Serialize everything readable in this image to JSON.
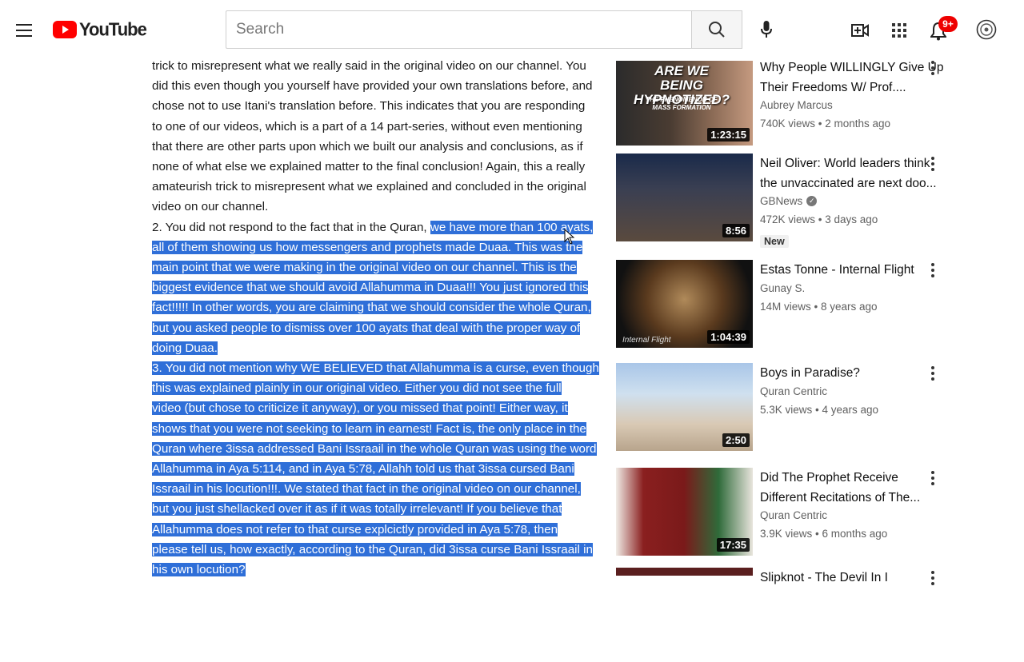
{
  "header": {
    "logo_text": "YouTube",
    "search_placeholder": "Search",
    "notification_count": "9+"
  },
  "comment": {
    "partial_top": "...",
    "lines": [
      {
        "text": "trick to misrepresent what we really said in the original video on our channel. You",
        "hl": ""
      },
      {
        "text": "did this even though you yourself have provided your own translations before, and",
        "hl": ""
      },
      {
        "text": "chose not to use Itani's translation before. This indicates that you are responding",
        "hl": ""
      },
      {
        "text": "to one of our videos, which is a part of a 14 part-series, without even mentioning",
        "hl": ""
      },
      {
        "text": "that there are other parts upon which we built our analysis and conclusions, as if",
        "hl": ""
      },
      {
        "text": "none of what else we explained matter to the final conclusion! Again, this a really",
        "hl": ""
      },
      {
        "text": "amateurish trick to misrepresent what we explained and concluded in the original",
        "hl": ""
      },
      {
        "text": "video on our channel.",
        "hl": ""
      },
      {
        "text": "2. You did not respond to the fact that in the Quran, ",
        "hl": "we have more than 100 ayats,"
      },
      {
        "text": "",
        "hl": "all of them showing us how messengers and prophets made Duaa. This was the"
      },
      {
        "text": "",
        "hl": "main point that we were making in the original video on our channel. This is the"
      },
      {
        "text": "",
        "hl": "biggest evidence that we should avoid Allahumma in Duaa!!! You just ignored this"
      },
      {
        "text": "",
        "hl": "fact!!!!! In other words, you are claiming that we should consider the whole Quran,"
      },
      {
        "text": "",
        "hl": "but you asked people to dismiss over 100 ayats that deal with the proper way of"
      },
      {
        "text": "",
        "hl": "doing Duaa.  "
      },
      {
        "text": "",
        "hl": "3. You did not mention why WE BELIEVED that Allahumma is a curse, even though"
      },
      {
        "text": "",
        "hl": "this was explained plainly in our original video. Either you did not see the full"
      },
      {
        "text": "",
        "hl": "video (but chose to criticize it anyway), or you missed that point! Either way, it"
      },
      {
        "text": "",
        "hl": "shows that you were not seeking to learn in earnest! Fact is, the only place in the"
      },
      {
        "text": "",
        "hl": "Quran where 3issa addressed Bani Issraail in the whole Quran was using the word"
      },
      {
        "text": "",
        "hl": "Allahumma in Aya 5:114, and in Aya 5:78, Allahh told us that 3issa cursed Bani"
      },
      {
        "text": "",
        "hl": "Issraail in his locution!!!. We stated that fact in the original video on our channel,"
      },
      {
        "text": "",
        "hl": "but you just shellacked over it as if it was totally irrelevant! If you believe that"
      },
      {
        "text": "",
        "hl": "Allahumma does not refer to that curse explcictly provided in Aya 5:78, then"
      },
      {
        "text": "",
        "hl": "please tell us, how exactly, according to the Quran, did 3issa curse Bani Issraail in"
      },
      {
        "text": "",
        "hl": "his own locution?  "
      }
    ]
  },
  "recommendations": [
    {
      "title_lines": [
        "Why People WILLINGLY Give Up",
        "Their Freedoms W/ Prof...."
      ],
      "channel": "Aubrey Marcus",
      "meta": "740K views • 2 months ago",
      "duration": "1:23:15",
      "thumb_text": "ARE WE BEING HYPNOTIZED?",
      "thumb_sub": "THE PHENOMENON OF MASS FORMATION",
      "verified": false,
      "new_badge": ""
    },
    {
      "title_lines": [
        "Neil Oliver: World leaders think",
        "the unvaccinated are next doo..."
      ],
      "channel": "GBNews",
      "meta": "472K views • 3 days ago",
      "duration": "8:56",
      "thumb_text": "",
      "thumb_sub": "",
      "verified": true,
      "new_badge": "New"
    },
    {
      "title_lines": [
        "Estas Tonne - Internal Flight"
      ],
      "channel": "Gunay S.",
      "meta": "14M views • 8 years ago",
      "duration": "1:04:39",
      "thumb_text": "Internal Flight",
      "thumb_sub": "",
      "verified": false,
      "new_badge": ""
    },
    {
      "title_lines": [
        "Boys in Paradise?"
      ],
      "channel": "Quran Centric",
      "meta": "5.3K views • 4 years ago",
      "duration": "2:50",
      "thumb_text": "",
      "thumb_sub": "",
      "verified": false,
      "new_badge": ""
    },
    {
      "title_lines": [
        "Did The Prophet Receive",
        "Different Recitations of The..."
      ],
      "channel": "Quran Centric",
      "meta": "3.9K views • 6 months ago",
      "duration": "17:35",
      "thumb_text": "",
      "thumb_sub": "",
      "verified": false,
      "new_badge": ""
    },
    {
      "title_lines": [
        "Slipknot - The Devil In I"
      ],
      "channel": "",
      "meta": "",
      "duration": "",
      "thumb_text": "",
      "thumb_sub": "",
      "verified": false,
      "new_badge": ""
    }
  ]
}
